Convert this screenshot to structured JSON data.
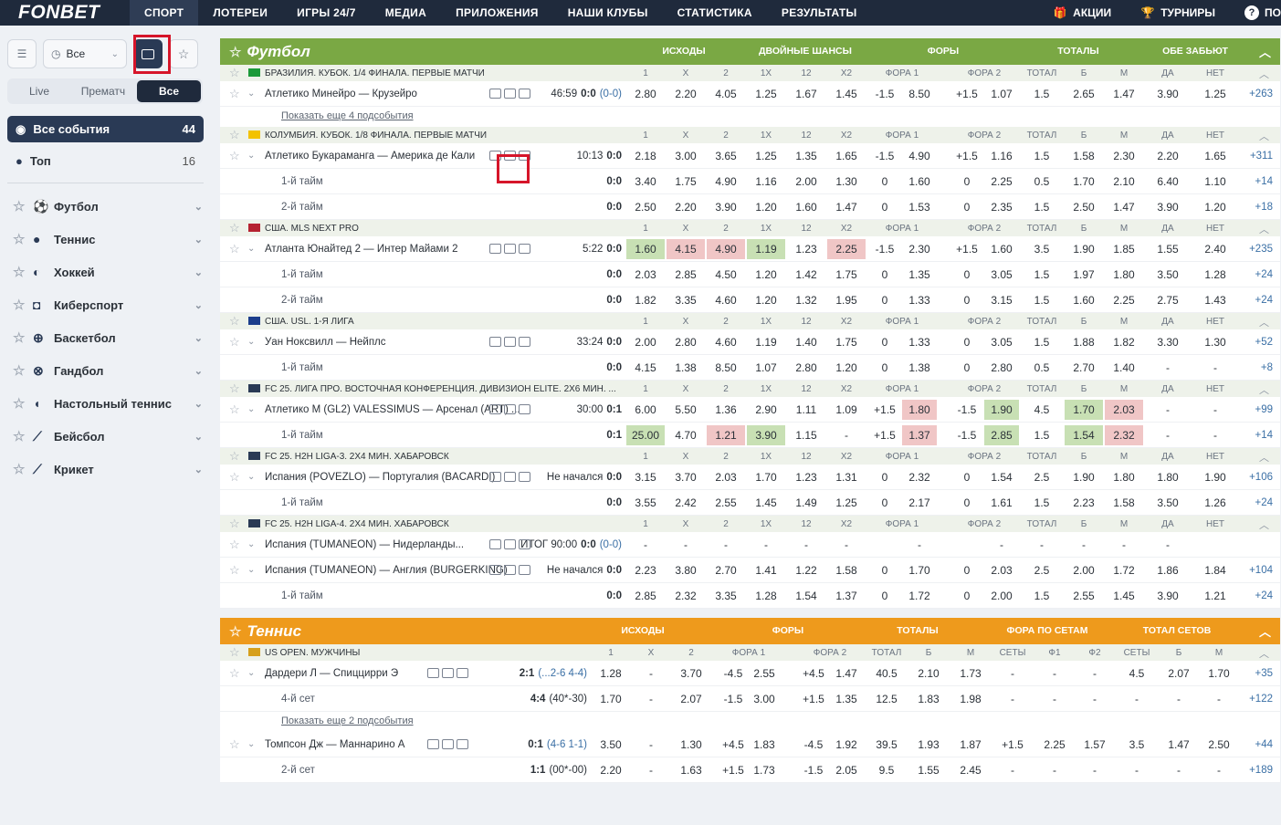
{
  "brand": {
    "logo": "FONBET",
    "accent_green": "#7aa844",
    "accent_orange": "#ee9a1c",
    "nav_bg": "#1f2a3c"
  },
  "nav": {
    "items": [
      "СПОРТ",
      "ЛОТЕРЕИ",
      "ИГРЫ 24/7",
      "МЕДИА",
      "ПРИЛОЖЕНИЯ",
      "НАШИ КЛУБЫ",
      "СТАТИСТИКА",
      "РЕЗУЛЬТАТЫ"
    ],
    "right": [
      "АКЦИИ",
      "ТУРНИРЫ",
      "ПО"
    ]
  },
  "sidebar": {
    "filter_select": "Все",
    "tabs": [
      "Live",
      "Прематч",
      "Все"
    ],
    "all_events": {
      "label": "Все события",
      "count": "44"
    },
    "top": {
      "label": "Топ",
      "count": "16"
    },
    "sports": [
      "Футбол",
      "Теннис",
      "Хоккей",
      "Киберспорт",
      "Баскетбол",
      "Гандбол",
      "Настольный теннис",
      "Бейсбол",
      "Крикет"
    ]
  },
  "football": {
    "title": "Футбол",
    "cols": [
      "ИСХОДЫ",
      "ДВОЙНЫЕ ШАНСЫ",
      "ФОРЫ",
      "ТОТАЛЫ",
      "ОБЕ ЗАБЬЮТ"
    ],
    "sub": [
      "1",
      "X",
      "2",
      "1X",
      "12",
      "X2",
      "ФОРА 1",
      "ФОРА 2",
      "ТОТАЛ",
      "Б",
      "М",
      "ДА",
      "НЕТ"
    ],
    "leagues": [
      {
        "name": "БРАЗИЛИЯ. КУБОК. 1/4 ФИНАЛА. ПЕРВЫЕ МАТЧИ"
      },
      {
        "name": "КОЛУМБИЯ. КУБОК. 1/8 ФИНАЛА. ПЕРВЫЕ МАТЧИ"
      },
      {
        "name": "США. MLS NEXT PRO"
      },
      {
        "name": "США. USL. 1-Я ЛИГА"
      },
      {
        "name": "FC 25. ЛИГА ПРО. ВОСТОЧНАЯ КОНФЕРЕНЦИЯ. ДИВИЗИОН ELITE. 2Х6 МИН. ..."
      },
      {
        "name": "FC 25. H2H LIGA-3. 2Х4 МИН. ХАБАРОВСК"
      },
      {
        "name": "FC 25. H2H LIGA-4. 2Х4 МИН. ХАБАРОВСК"
      }
    ],
    "rows": [
      {
        "name": "Атлетико Минейро — Крузейро",
        "time": "46:59",
        "score": "0:0",
        "extra": "(0-0)",
        "odds": [
          "2.80",
          "2.20",
          "4.05",
          "1.25",
          "1.67",
          "1.45",
          "-1.5",
          "8.50",
          "+1.5",
          "1.07",
          "1.5",
          "2.65",
          "1.47",
          "3.90",
          "1.25"
        ],
        "more": "+263"
      },
      {
        "show_more": "Показать еще 4 подсобытия"
      },
      {
        "name": "Атлетико Букараманга — Америка де Кали",
        "time": "10:13",
        "score": "0:0",
        "extra": "",
        "odds": [
          "2.18",
          "3.00",
          "3.65",
          "1.25",
          "1.35",
          "1.65",
          "-1.5",
          "4.90",
          "+1.5",
          "1.16",
          "1.5",
          "1.58",
          "2.30",
          "2.20",
          "1.65"
        ],
        "more": "+311"
      },
      {
        "sub": "1-й тайм",
        "score": "0:0",
        "odds": [
          "3.40",
          "1.75",
          "4.90",
          "1.16",
          "2.00",
          "1.30",
          "0",
          "1.60",
          "0",
          "2.25",
          "0.5",
          "1.70",
          "2.10",
          "6.40",
          "1.10"
        ],
        "more": "+14"
      },
      {
        "sub": "2-й тайм",
        "score": "0:0",
        "odds": [
          "2.50",
          "2.20",
          "3.90",
          "1.20",
          "1.60",
          "1.47",
          "0",
          "1.53",
          "0",
          "2.35",
          "1.5",
          "2.50",
          "1.47",
          "3.90",
          "1.20"
        ],
        "more": "+18"
      },
      {
        "name": "Атланта Юнайтед 2 — Интер Майами 2",
        "time": "5:22",
        "score": "0:0",
        "extra": "",
        "odds": [
          "1.60",
          "4.15",
          "4.90",
          "1.19",
          "1.23",
          "2.25",
          "-1.5",
          "2.30",
          "+1.5",
          "1.60",
          "3.5",
          "1.90",
          "1.85",
          "1.55",
          "2.40"
        ],
        "more": "+235",
        "hl": {
          "0": "g",
          "1": "r",
          "2": "r",
          "3": "g",
          "5": "r"
        }
      },
      {
        "sub": "1-й тайм",
        "score": "0:0",
        "odds": [
          "2.03",
          "2.85",
          "4.50",
          "1.20",
          "1.42",
          "1.75",
          "0",
          "1.35",
          "0",
          "3.05",
          "1.5",
          "1.97",
          "1.80",
          "3.50",
          "1.28"
        ],
        "more": "+24"
      },
      {
        "sub": "2-й тайм",
        "score": "0:0",
        "odds": [
          "1.82",
          "3.35",
          "4.60",
          "1.20",
          "1.32",
          "1.95",
          "0",
          "1.33",
          "0",
          "3.15",
          "1.5",
          "1.60",
          "2.25",
          "2.75",
          "1.43"
        ],
        "more": "+24"
      },
      {
        "name": "Уан Ноксвилл — Нейплс",
        "time": "33:24",
        "score": "0:0",
        "extra": "",
        "odds": [
          "2.00",
          "2.80",
          "4.60",
          "1.19",
          "1.40",
          "1.75",
          "0",
          "1.33",
          "0",
          "3.05",
          "1.5",
          "1.88",
          "1.82",
          "3.30",
          "1.30"
        ],
        "more": "+52"
      },
      {
        "sub": "1-й тайм",
        "score": "0:0",
        "odds": [
          "4.15",
          "1.38",
          "8.50",
          "1.07",
          "2.80",
          "1.20",
          "0",
          "1.38",
          "0",
          "2.80",
          "0.5",
          "2.70",
          "1.40",
          "-",
          "-"
        ],
        "more": "+8"
      },
      {
        "name": "Атлетико М (GL2) VALESSIMUS — Арсенал (ART) ...",
        "time": "30:00",
        "score": "0:1",
        "extra": "",
        "odds": [
          "6.00",
          "5.50",
          "1.36",
          "2.90",
          "1.11",
          "1.09",
          "+1.5",
          "1.80",
          "-1.5",
          "1.90",
          "4.5",
          "1.70",
          "2.03",
          "-",
          "-"
        ],
        "more": "+99",
        "hl": {
          "7": "r",
          "9": "g",
          "11": "g",
          "12": "r"
        }
      },
      {
        "sub": "1-й тайм",
        "score": "0:1",
        "odds": [
          "25.00",
          "4.70",
          "1.21",
          "3.90",
          "1.15",
          "-",
          "+1.5",
          "1.37",
          "-1.5",
          "2.85",
          "1.5",
          "1.54",
          "2.32",
          "-",
          "-"
        ],
        "more": "+14",
        "hl": {
          "0": "g",
          "2": "r",
          "3": "g",
          "7": "r",
          "9": "g",
          "11": "g",
          "12": "r"
        }
      },
      {
        "name": "Испания (POVEZLO) — Португалия (BACARDI)",
        "time": "Не начался",
        "score": "0:0",
        "extra": "",
        "odds": [
          "3.15",
          "3.70",
          "2.03",
          "1.70",
          "1.23",
          "1.31",
          "0",
          "2.32",
          "0",
          "1.54",
          "2.5",
          "1.90",
          "1.80",
          "1.80",
          "1.90"
        ],
        "more": "+106"
      },
      {
        "sub": "1-й тайм",
        "score": "0:0",
        "odds": [
          "3.55",
          "2.42",
          "2.55",
          "1.45",
          "1.49",
          "1.25",
          "0",
          "2.17",
          "0",
          "1.61",
          "1.5",
          "2.23",
          "1.58",
          "3.50",
          "1.26"
        ],
        "more": "+24"
      },
      {
        "name": "Испания (TUMANEON) — Нидерланды...",
        "time": "ИТОГ 90:00",
        "score": "0:0",
        "extra": "(0-0)",
        "odds": [
          "-",
          "-",
          "-",
          "-",
          "-",
          "-",
          "",
          "-",
          "",
          "-",
          "-",
          "-",
          "-",
          "-",
          ""
        ],
        "more": ""
      },
      {
        "name": "Испания (TUMANEON) — Англия (BURGERKING)",
        "time": "Не начался",
        "score": "0:0",
        "extra": "",
        "odds": [
          "2.23",
          "3.80",
          "2.70",
          "1.41",
          "1.22",
          "1.58",
          "0",
          "1.70",
          "0",
          "2.03",
          "2.5",
          "2.00",
          "1.72",
          "1.86",
          "1.84"
        ],
        "more": "+104"
      },
      {
        "sub": "1-й тайм",
        "score": "0:0",
        "odds": [
          "2.85",
          "2.32",
          "3.35",
          "1.28",
          "1.54",
          "1.37",
          "0",
          "1.72",
          "0",
          "2.00",
          "1.5",
          "2.55",
          "1.45",
          "3.90",
          "1.21"
        ],
        "more": "+24"
      }
    ]
  },
  "tennis": {
    "title": "Теннис",
    "cols": [
      "ИСХОДЫ",
      "ФОРЫ",
      "ТОТАЛЫ",
      "ФОРА ПО СЕТАМ",
      "ТОТАЛ СЕТОВ"
    ],
    "league": "US OPEN. МУЖЧИНЫ",
    "sub": [
      "1",
      "X",
      "2",
      "ФОРА 1",
      "ФОРА 2",
      "ТОТАЛ",
      "Б",
      "М",
      "СЕТЫ",
      "Ф1",
      "Ф2",
      "СЕТЫ",
      "Б",
      "М"
    ],
    "rows": [
      {
        "name": "Дардери Л — Спиццирри Э",
        "score": "2:1",
        "extra": "(...2-6 4-4)",
        "odds": [
          "1.28",
          "-",
          "3.70",
          "-4.5",
          "2.55",
          "+4.5",
          "1.47",
          "40.5",
          "2.10",
          "1.73",
          "-",
          "-",
          "-",
          "4.5",
          "2.07",
          "1.70"
        ],
        "more": "+35"
      },
      {
        "sub": "4-й сет",
        "score": "4:4",
        "extra": "(40*-30)",
        "odds": [
          "1.70",
          "-",
          "2.07",
          "-1.5",
          "3.00",
          "+1.5",
          "1.35",
          "12.5",
          "1.83",
          "1.98",
          "-",
          "-",
          "-",
          "-",
          "-",
          "-"
        ],
        "more": "+122"
      },
      {
        "show_more": "Показать еще 2 подсобытия"
      },
      {
        "name": "Томпсон Дж — Маннарино А",
        "score": "0:1",
        "extra": "(4-6 1-1)",
        "odds": [
          "3.50",
          "-",
          "1.30",
          "+4.5",
          "1.83",
          "-4.5",
          "1.92",
          "39.5",
          "1.93",
          "1.87",
          "+1.5",
          "2.25",
          "1.57",
          "3.5",
          "1.47",
          "2.50"
        ],
        "more": "+44"
      },
      {
        "sub": "2-й сет",
        "score": "1:1",
        "extra": "(00*-00)",
        "odds": [
          "2.20",
          "-",
          "1.63",
          "+1.5",
          "1.73",
          "-1.5",
          "2.05",
          "9.5",
          "1.55",
          "2.45",
          "-",
          "-",
          "-",
          "-",
          "-",
          "-"
        ],
        "more": "+189"
      }
    ]
  }
}
